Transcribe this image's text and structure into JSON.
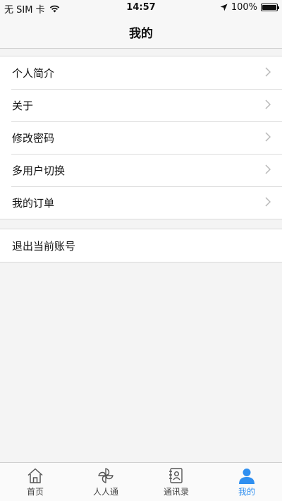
{
  "status_bar": {
    "carrier": "无 SIM 卡",
    "time": "14:57",
    "battery_percent": "100%",
    "battery_level": 1.0
  },
  "nav": {
    "title": "我的"
  },
  "menu": {
    "group1": [
      {
        "label": "个人简介"
      },
      {
        "label": "关于"
      },
      {
        "label": "修改密码"
      },
      {
        "label": "多用户切换"
      },
      {
        "label": "我的订单"
      }
    ],
    "logout_label": "退出当前账号"
  },
  "tabs": [
    {
      "label": "首页",
      "icon": "home-icon",
      "active": false
    },
    {
      "label": "人人通",
      "icon": "pinwheel-icon",
      "active": false
    },
    {
      "label": "通讯录",
      "icon": "contacts-book-icon",
      "active": false
    },
    {
      "label": "我的",
      "icon": "user-icon",
      "active": true
    }
  ],
  "colors": {
    "accent": "#2f8ff0",
    "inactive": "#444444"
  }
}
